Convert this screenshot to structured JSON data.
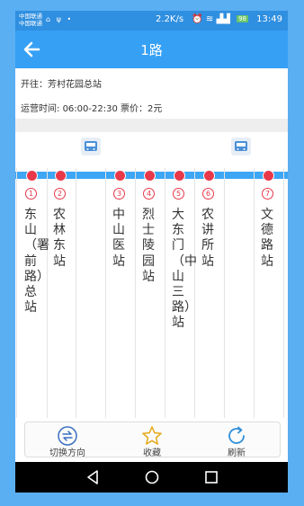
{
  "status_bar": {
    "carrier_line1": "中国联通",
    "carrier_line2": "中国联通",
    "icons": [
      "notification-icon",
      "usb-icon",
      "dot-icon"
    ],
    "speed": "2.2K/s",
    "battery": "98",
    "time": "13:49"
  },
  "header": {
    "title": "1路"
  },
  "info": {
    "direction_label": "开往：",
    "direction_value": "芳村花园总站",
    "hours_label": "运营时间: ",
    "hours_value": "06:00-22:30",
    "fare_label": " 票价：",
    "fare_value": "2元"
  },
  "route": {
    "stops": [
      {
        "num": "1",
        "name": "东山（署前路）总站"
      },
      {
        "num": "2",
        "name": "农林东站"
      },
      {
        "num": "",
        "name": ""
      },
      {
        "num": "3",
        "name": "中山医站"
      },
      {
        "num": "4",
        "name": "烈士陵园站"
      },
      {
        "num": "5",
        "name": "大东门（中山三路）站"
      },
      {
        "num": "6",
        "name": "农讲所站"
      },
      {
        "num": "",
        "name": ""
      },
      {
        "num": "7",
        "name": "文德路站"
      }
    ],
    "colors": {
      "line": "#3da6f5",
      "stop": "#e8394a"
    }
  },
  "bottom_bar": {
    "switch_label": "切换方向",
    "favorite_label": "收藏",
    "refresh_label": "刷新"
  },
  "colors": {
    "header": "#36a0f5",
    "status": "#2f8fe0",
    "accent": "#e8394a",
    "frame": "#5aaef2"
  }
}
